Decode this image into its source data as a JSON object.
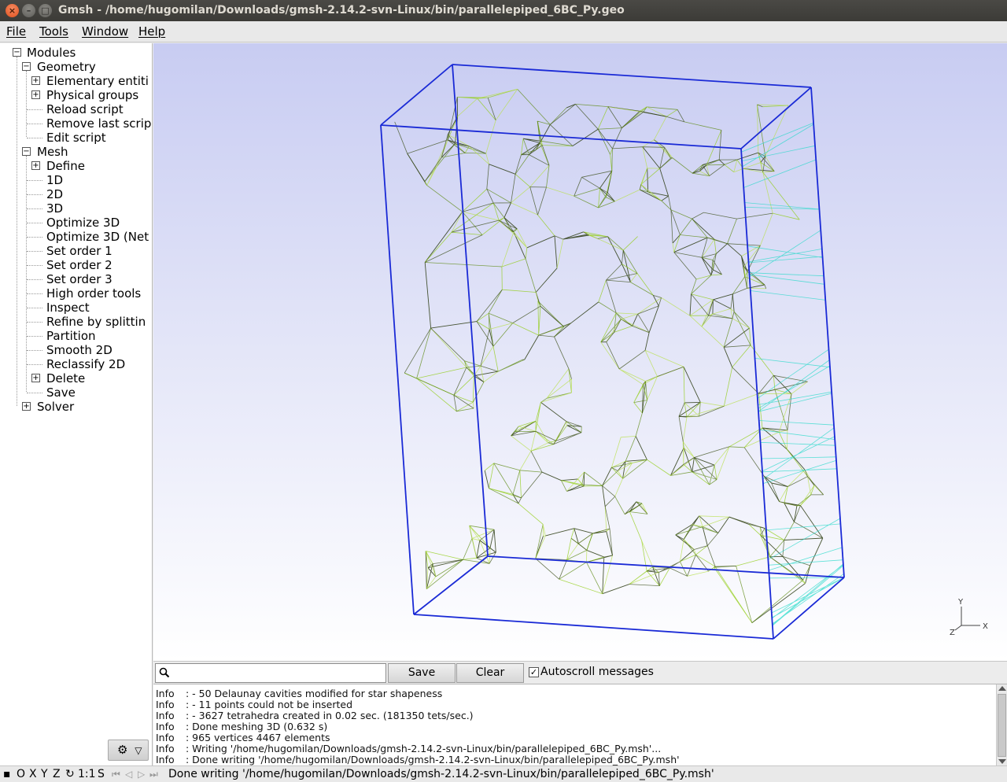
{
  "window": {
    "title": "Gmsh - /home/hugomilan/Downloads/gmsh-2.14.2-svn-Linux/bin/parallelepiped_6BC_Py.geo",
    "close_glyph": "×",
    "min_glyph": "–",
    "max_glyph": "□"
  },
  "menu": [
    "File",
    "Tools",
    "Window",
    "Help"
  ],
  "tree": {
    "root": "Modules",
    "geometry": {
      "label": "Geometry",
      "items": [
        "Elementary entiti",
        "Physical groups",
        "Reload script",
        "Remove last scrip",
        "Edit script"
      ]
    },
    "mesh": {
      "label": "Mesh",
      "items": [
        "Define",
        "1D",
        "2D",
        "3D",
        "Optimize 3D",
        "Optimize 3D (Net",
        "Set order 1",
        "Set order 2",
        "Set order 3",
        "High order tools",
        "Inspect",
        "Refine by splittin",
        "Partition",
        "Smooth 2D",
        "Reclassify 2D",
        "Delete",
        "Save"
      ]
    },
    "solver": "Solver",
    "expand_glyph": "+",
    "collapse_glyph": "−"
  },
  "gear": {
    "glyph": "⚙",
    "arrow": "▽"
  },
  "axes": {
    "y": "Y",
    "z": "Z",
    "x": "X"
  },
  "messages": {
    "search_placeholder": "",
    "save_label": "Save",
    "clear_label": "Clear",
    "autoscroll_label": "Autoscroll messages",
    "autoscroll_checked": "✓",
    "lines": [
      [
        "Info",
        ":  - 50 Delaunay cavities modified for star shapeness"
      ],
      [
        "Info",
        ":  - 11 points could not be inserted"
      ],
      [
        "Info",
        ":  - 3627 tetrahedra created in 0.02 sec. (181350 tets/sec.)"
      ],
      [
        "Info",
        ": Done meshing 3D (0.632 s)"
      ],
      [
        "Info",
        ": 965 vertices 4467 elements"
      ],
      [
        "Info",
        ": Writing '/home/hugomilan/Downloads/gmsh-2.14.2-svn-Linux/bin/parallelepiped_6BC_Py.msh'..."
      ],
      [
        "Info",
        ": Done writing '/home/hugomilan/Downloads/gmsh-2.14.2-svn-Linux/bin/parallelepiped_6BC_Py.msh'"
      ]
    ]
  },
  "status": {
    "buttons": [
      "O",
      "X",
      "Y",
      "Z"
    ],
    "rotate_glyph": "↻",
    "scale": "1:1",
    "s_label": "S",
    "anim_glyphs": [
      "⏮",
      "◁",
      "▷",
      "⏭"
    ],
    "message": "Done writing '/home/hugomilan/Downloads/gmsh-2.14.2-svn-Linux/bin/parallelepiped_6BC_Py.msh'"
  },
  "colors": {
    "box_edge": "#1a2ad6",
    "mesh_dark": "#2a3a10",
    "mesh_green": "#8fcc10",
    "mesh_cyan": "#20d8c8"
  }
}
